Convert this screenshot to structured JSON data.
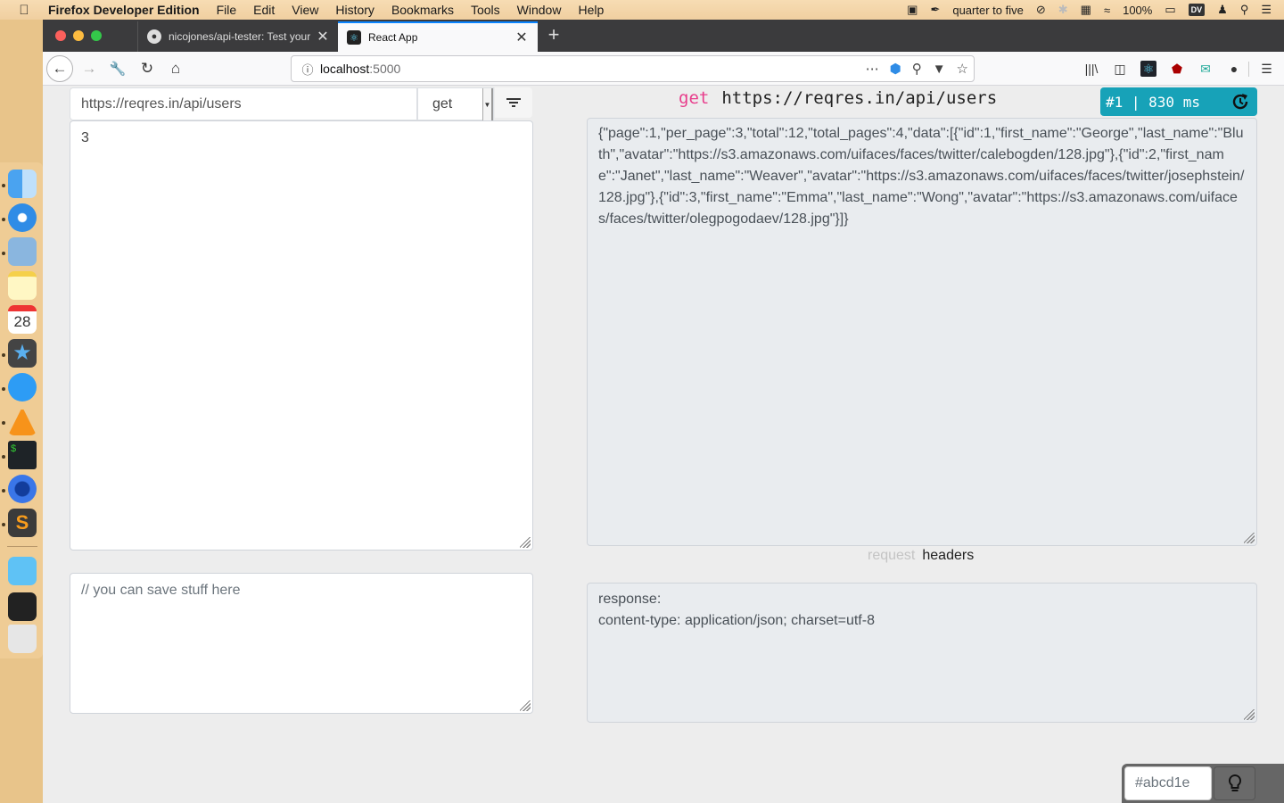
{
  "menubar": {
    "app_name": "Firefox Developer Edition",
    "menus": [
      "File",
      "Edit",
      "View",
      "History",
      "Bookmarks",
      "Tools",
      "Window",
      "Help"
    ],
    "clock_text": "quarter to five",
    "battery": "100%",
    "dv_badge": "DV"
  },
  "browser": {
    "tabs": [
      {
        "title": "nicojones/api-tester: Test your",
        "icon": "github-icon",
        "active": false
      },
      {
        "title": "React App",
        "icon": "react-icon",
        "active": true
      }
    ],
    "url_host": "localhost",
    "url_port": ":5000"
  },
  "app": {
    "request_url": "https://reqres.in/api/users",
    "method": "get",
    "body_value": "3",
    "notes_placeholder": "// you can save stuff here",
    "request_line": {
      "method": "get",
      "url": "https://reqres.in/api/users"
    },
    "timing": {
      "label": "#1 | 830 ms",
      "accent": "#17a2b8"
    },
    "response_body": "{\"page\":1,\"per_page\":3,\"total\":12,\"total_pages\":4,\"data\":[{\"id\":1,\"first_name\":\"George\",\"last_name\":\"Bluth\",\"avatar\":\"https://s3.amazonaws.com/uifaces/faces/twitter/calebogden/128.jpg\"},{\"id\":2,\"first_name\":\"Janet\",\"last_name\":\"Weaver\",\"avatar\":\"https://s3.amazonaws.com/uifaces/faces/twitter/josephstein/128.jpg\"},{\"id\":3,\"first_name\":\"Emma\",\"last_name\":\"Wong\",\"avatar\":\"https://s3.amazonaws.com/uifaces/faces/twitter/olegpogodaev/128.jpg\"}]}",
    "view_tabs": [
      {
        "label": "request",
        "active": false
      },
      {
        "label": "headers",
        "active": true
      }
    ],
    "headers_lines": [
      "response:",
      "content-type: application/json; charset=utf-8"
    ],
    "color_input_value": "#abcd1e"
  }
}
